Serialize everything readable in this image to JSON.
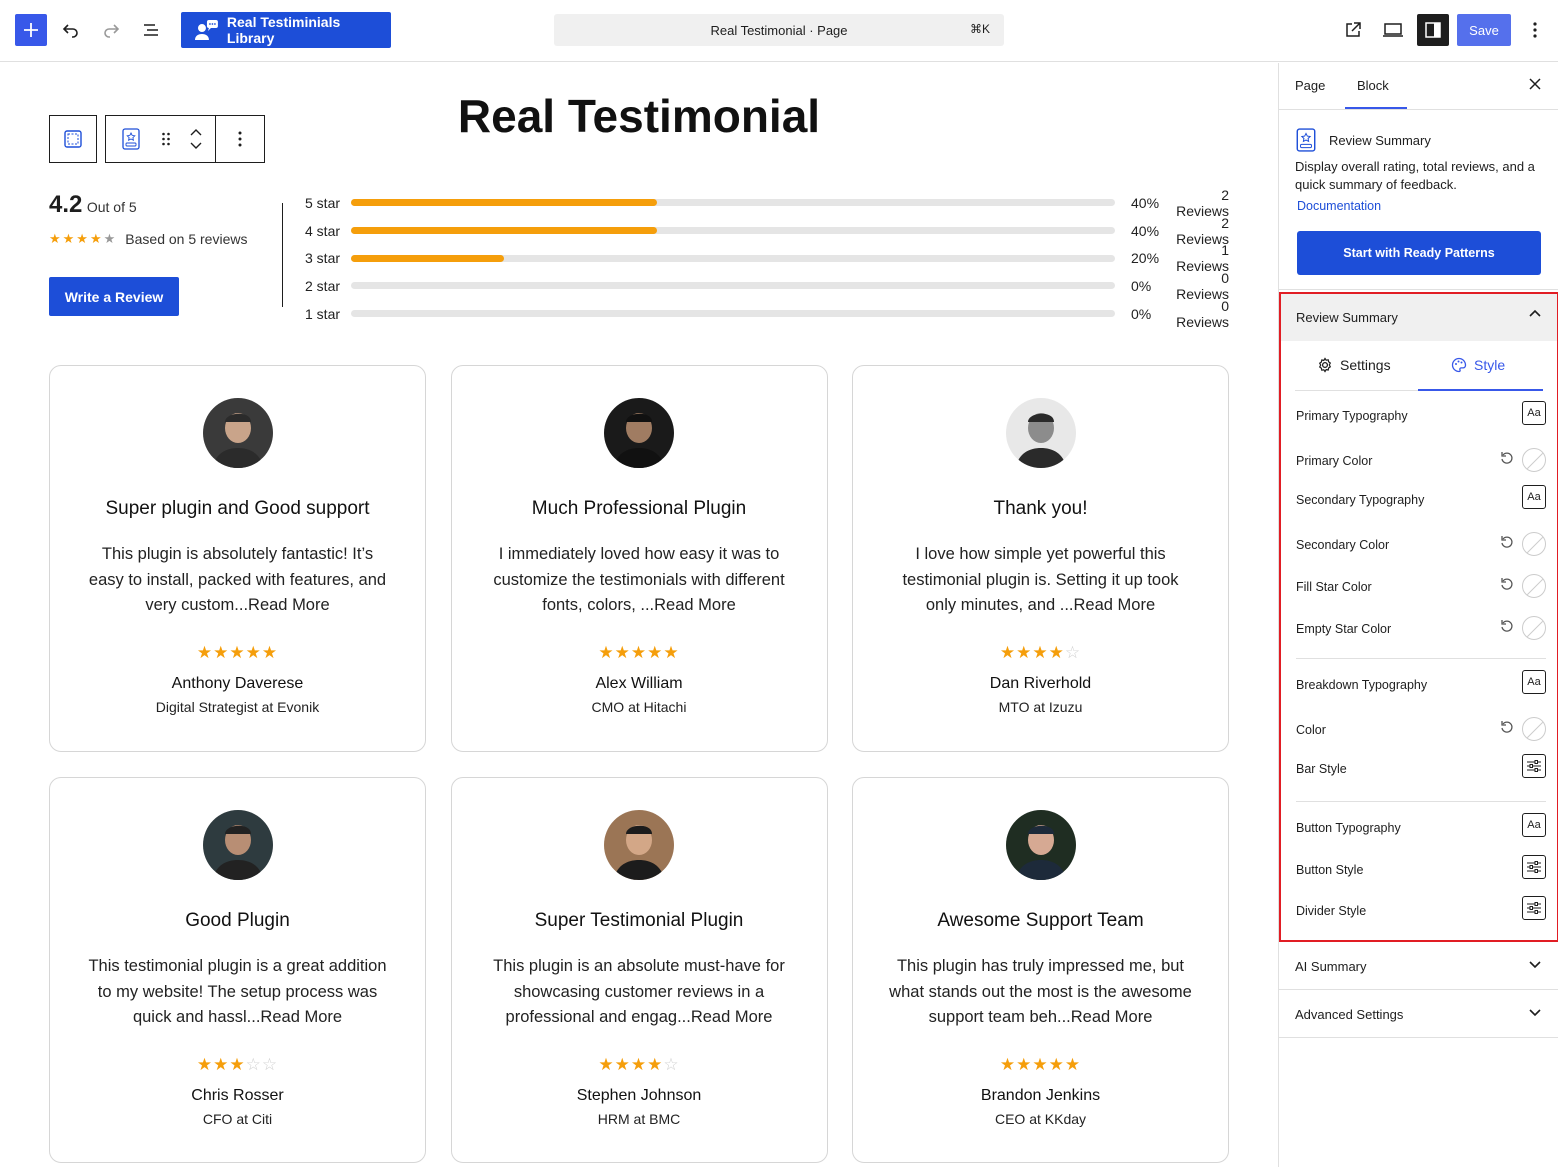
{
  "toolbar": {
    "library_label": "Real Testiminials Library",
    "command_title": "Real Testimonial · Page",
    "command_shortcut": "⌘K",
    "save_label": "Save"
  },
  "page": {
    "title": "Real Testimonial"
  },
  "summary": {
    "rating": "4.2",
    "out_of": "Out of 5",
    "based_on": "Based on 5 reviews",
    "write_review_label": "Write a Review",
    "rating_stars": 4,
    "breakdown": [
      {
        "label": "5 star",
        "percent": 40,
        "percent_text": "40%",
        "reviews": "2 Reviews"
      },
      {
        "label": "4 star",
        "percent": 40,
        "percent_text": "40%",
        "reviews": "2 Reviews"
      },
      {
        "label": "3 star",
        "percent": 20,
        "percent_text": "20%",
        "reviews": "1 Reviews"
      },
      {
        "label": "2 star",
        "percent": 0,
        "percent_text": "0%",
        "reviews": "0 Reviews"
      },
      {
        "label": "1 star",
        "percent": 0,
        "percent_text": "0%",
        "reviews": "0 Reviews"
      }
    ]
  },
  "testimonials": [
    {
      "title": "Super plugin and Good support",
      "text": "This plugin is absolutely fantastic! It’s easy to install, packed with features, and very custom...Read More",
      "stars": 5,
      "name": "Anthony Daverese",
      "role": "Digital Strategist at Evonik"
    },
    {
      "title": "Much Professional Plugin",
      "text": "I immediately loved how easy it was to customize the testimonials with different fonts, colors, ...Read More",
      "stars": 5,
      "name": "Alex William",
      "role": "CMO at Hitachi"
    },
    {
      "title": "Thank you!",
      "text": "I love how simple yet powerful this testimonial plugin is. Setting it up took only minutes, and ...Read More",
      "stars": 4,
      "name": "Dan Riverhold",
      "role": "MTO at Izuzu"
    },
    {
      "title": "Good Plugin",
      "text": "This testimonial plugin is a great addition to my website! The setup process was quick and hassl...Read More",
      "stars": 3,
      "name": "Chris Rosser",
      "role": "CFO at Citi"
    },
    {
      "title": "Super Testimonial Plugin",
      "text": "This plugin is an absolute must-have for showcasing customer reviews in a professional and engag...Read More",
      "stars": 4,
      "name": "Stephen Johnson",
      "role": "HRM at BMC"
    },
    {
      "title": "Awesome Support Team",
      "text": "This plugin has truly impressed me, but what stands out the most is the awesome support team beh...Read More",
      "stars": 5,
      "name": "Brandon Jenkins",
      "role": "CEO at KKday"
    }
  ],
  "sidebar": {
    "tab_page": "Page",
    "tab_block": "Block",
    "block_name": "Review Summary",
    "block_description": "Display overall rating, total reviews, and a quick summary of feedback.",
    "documentation_label": "Documentation",
    "patterns_button_label": "Start with Ready Patterns",
    "panel_title": "Review Summary",
    "settings_tab": "Settings",
    "style_tab": "Style",
    "options": {
      "primary_typography": "Primary Typography",
      "primary_color": "Primary Color",
      "secondary_typography": "Secondary Typography",
      "secondary_color": "Secondary Color",
      "fill_star_color": "Fill Star Color",
      "empty_star_color": "Empty Star Color",
      "breakdown_typography": "Breakdown Typography",
      "color": "Color",
      "bar_style": "Bar Style",
      "button_typography": "Button Typography",
      "button_style": "Button Style",
      "divider_style": "Divider Style"
    },
    "ai_summary": "AI Summary",
    "advanced_settings": "Advanced Settings"
  },
  "colors": {
    "wp_blue": "#3858e9",
    "brand_blue": "#1d4ed8",
    "star": "#f59e0b",
    "highlight": "#e11d24"
  }
}
